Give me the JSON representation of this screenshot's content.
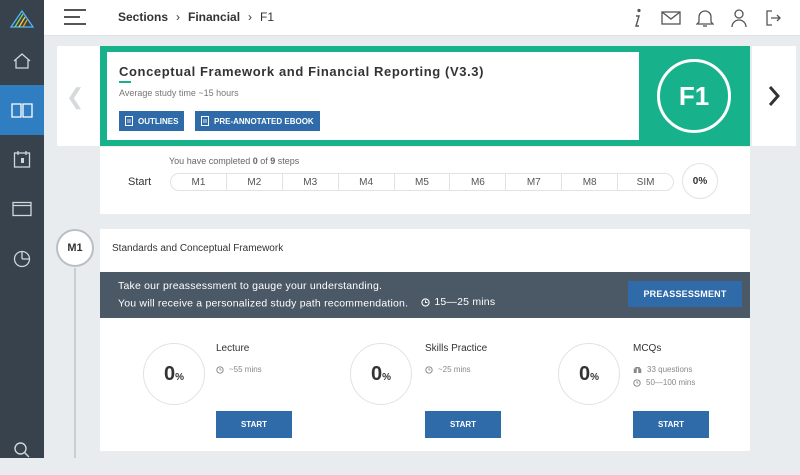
{
  "header": {
    "breadcrumb": [
      "Sections",
      "Financial",
      "F1"
    ],
    "icons": [
      "info-icon",
      "mail-icon",
      "bell-icon",
      "user-icon",
      "logout-icon"
    ]
  },
  "sidebar": {
    "items": [
      "home-icon",
      "book-icon",
      "calendar-icon",
      "window-icon",
      "pie-chart-icon",
      "search-icon"
    ],
    "active": "book-icon"
  },
  "course": {
    "title": "Conceptual Framework and Financial Reporting (V3.3)",
    "study_time": "Average study time ~15 hours",
    "outlines_label": "OUTLINES",
    "ebook_label": "PRE-ANNOTATED EBOOK",
    "badge": "F1"
  },
  "progress": {
    "completed_prefix": "You have completed ",
    "completed_count": "0",
    "completed_mid": " of ",
    "total_steps": "9",
    "completed_suffix": " steps",
    "start_label": "Start",
    "steps": [
      "M1",
      "M2",
      "M3",
      "M4",
      "M5",
      "M6",
      "M7",
      "M8",
      "SIM"
    ],
    "percent": "0%"
  },
  "module": {
    "badge": "M1",
    "title": "Standards and Conceptual Framework",
    "pre_line1": "Take our preassessment to gauge your understanding.",
    "pre_line2": "You will receive a personalized study path recommendation.",
    "pre_time": "15—25 mins",
    "pre_button": "PREASSESSMENT",
    "activities": [
      {
        "title": "Lecture",
        "value": "0",
        "unit": "%",
        "meta1": "~55 mins",
        "meta2": "",
        "button": "START"
      },
      {
        "title": "Skills Practice",
        "value": "0",
        "unit": "%",
        "meta1": "~25 mins",
        "meta2": "",
        "button": "START"
      },
      {
        "title": "MCQs",
        "value": "0",
        "unit": "%",
        "meta1": "33 questions",
        "meta2": "50—100 mins",
        "button": "START"
      }
    ]
  },
  "colors": {
    "accent_green": "#17b28b",
    "primary_blue": "#2f6aa9",
    "sidebar": "#37424d",
    "active_sidebar": "#2e7ec1"
  }
}
